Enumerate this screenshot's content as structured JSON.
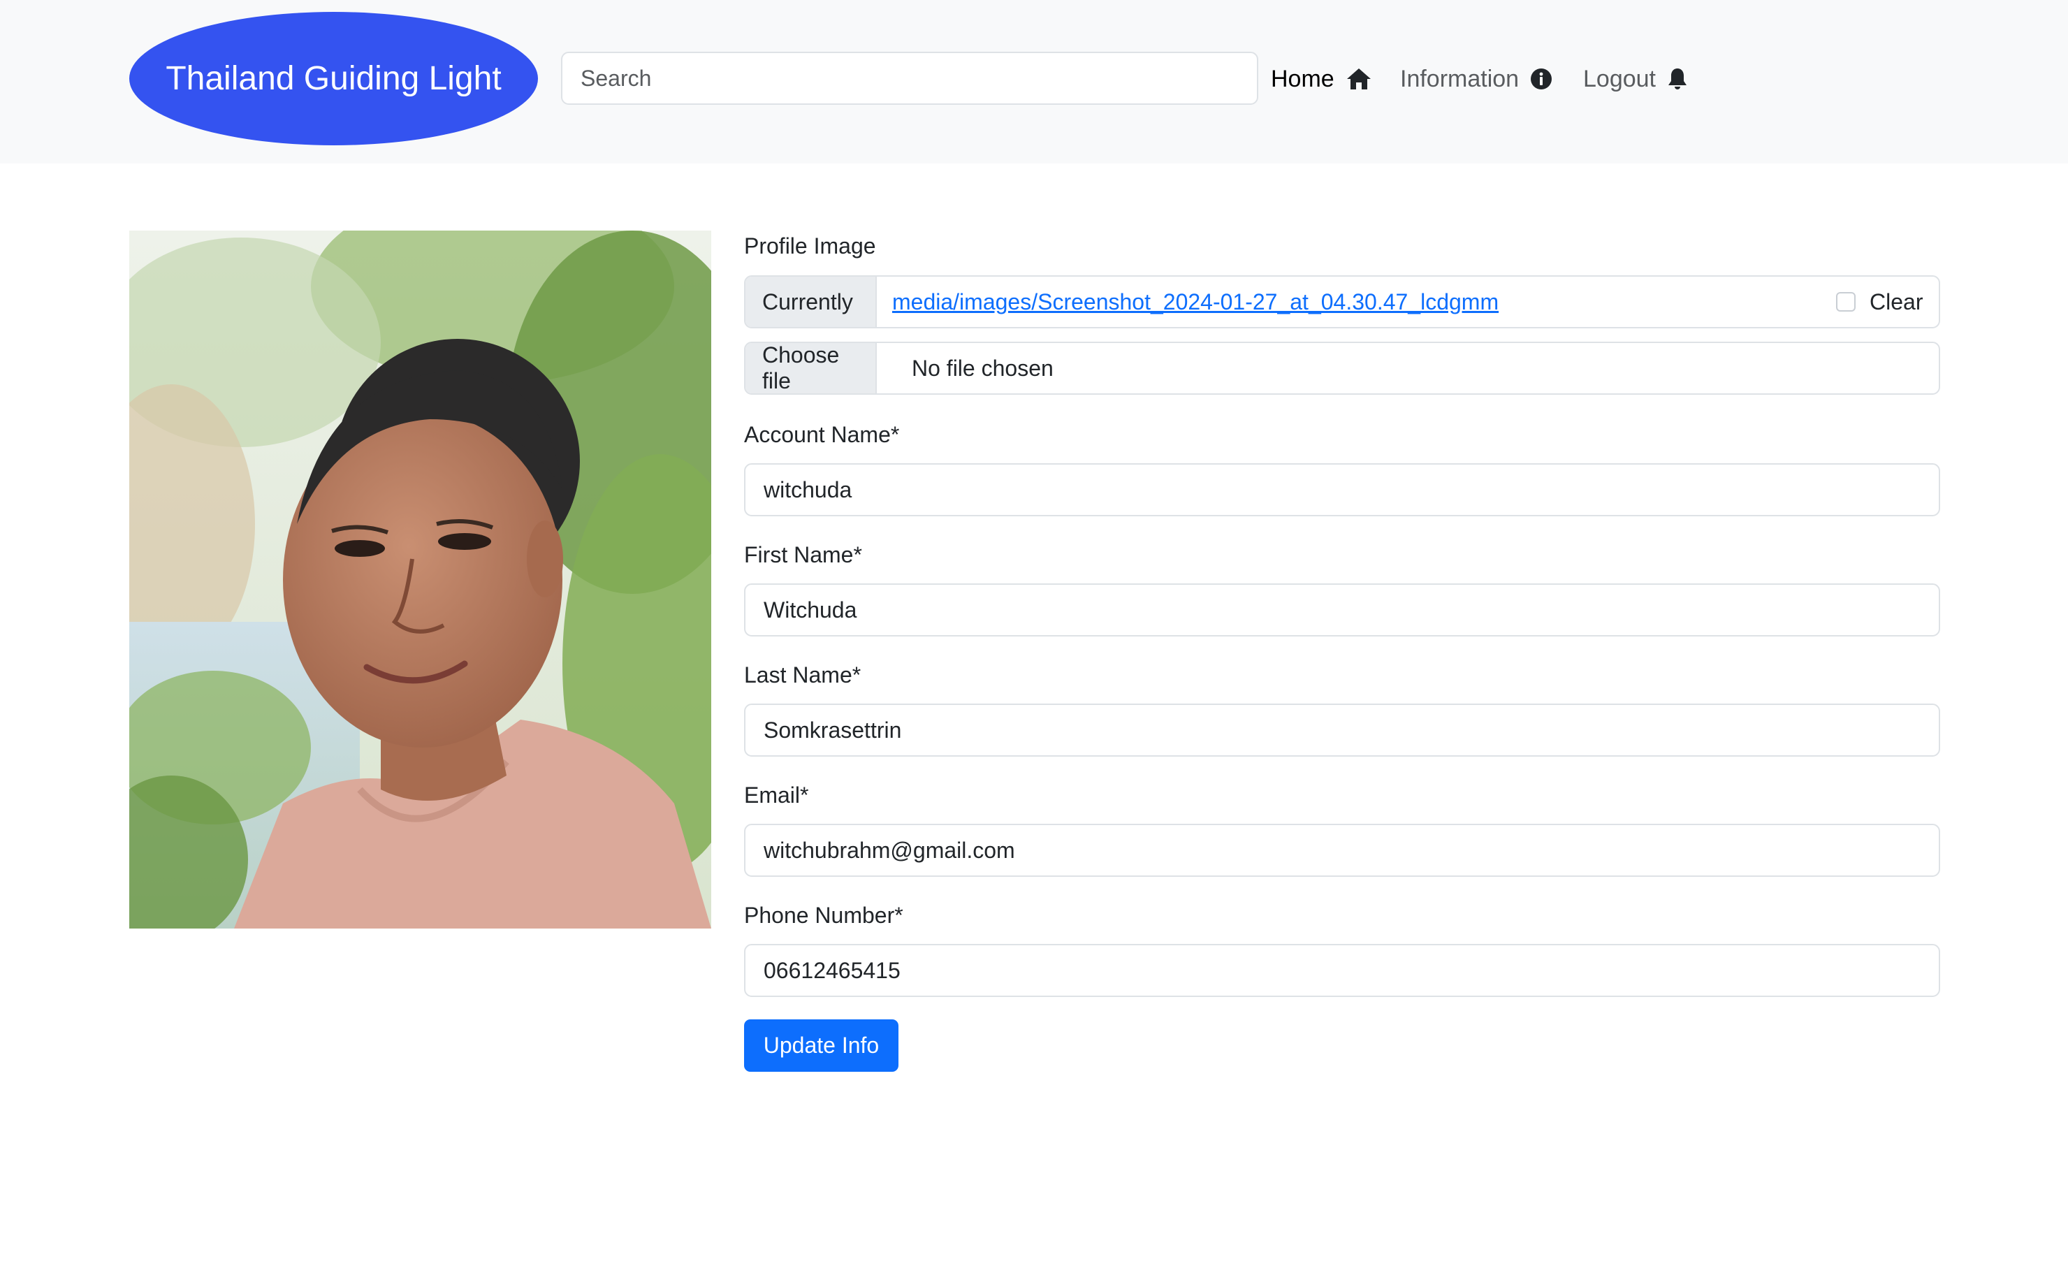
{
  "navbar": {
    "brand": "Thailand Guiding Light",
    "search_placeholder": "Search",
    "links": [
      {
        "label": "Home",
        "icon": "home-icon",
        "active": true
      },
      {
        "label": "Information",
        "icon": "info-icon",
        "active": false
      },
      {
        "label": "Logout",
        "icon": "bell-icon",
        "active": false
      }
    ]
  },
  "profile": {
    "photo_alt": "Profile photo"
  },
  "form": {
    "profile_image_label": "Profile Image",
    "currently_label": "Currently",
    "current_file": "media/images/Screenshot_2024-01-27_at_04.30.47_lcdgmm",
    "clear_label": "Clear",
    "choose_file_label": "Choose file",
    "no_file_text": "No file chosen",
    "fields": [
      {
        "label": "Account Name*",
        "value": "witchuda"
      },
      {
        "label": "First Name*",
        "value": "Witchuda"
      },
      {
        "label": "Last Name*",
        "value": "Somkrasettrin"
      },
      {
        "label": "Email*",
        "value": "witchubrahm@gmail.com"
      },
      {
        "label": "Phone Number*",
        "value": "06612465415"
      }
    ],
    "submit_label": "Update Info"
  },
  "colors": {
    "brand": "#3453f0",
    "primary": "#0d6efd",
    "navbar_bg": "#f8f9fa"
  }
}
